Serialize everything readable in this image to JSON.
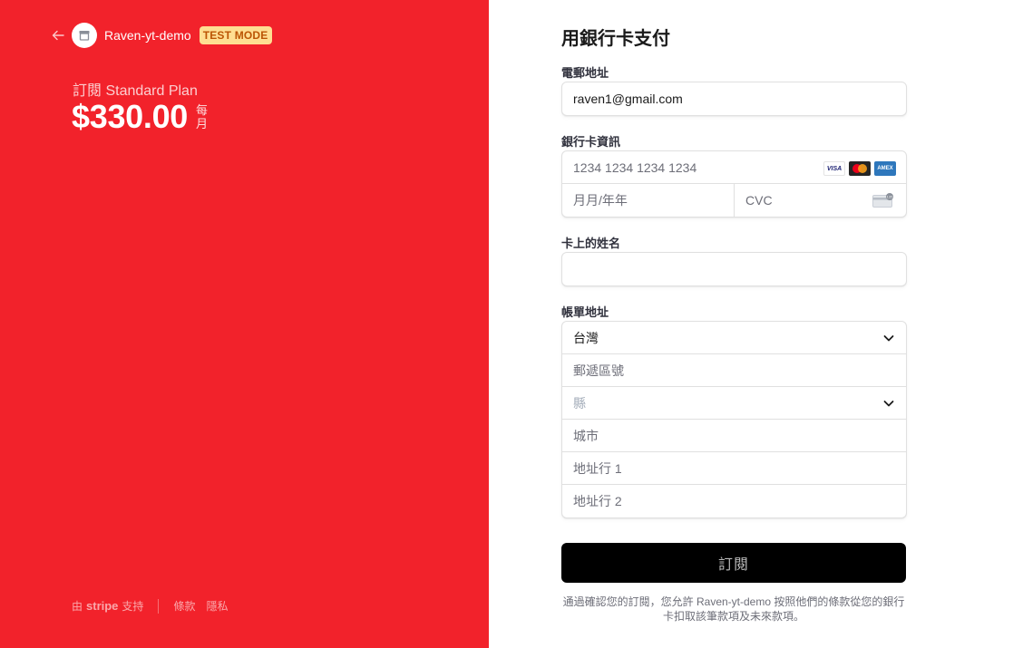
{
  "merchant": {
    "name": "Raven-yt-demo",
    "badge": "TEST MODE"
  },
  "summary": {
    "plan_label": "訂閱 Standard Plan",
    "price": "$330.00",
    "period": "每月"
  },
  "footer": {
    "powered_prefix": "由",
    "brand": "stripe",
    "powered_suffix": "支持",
    "terms_link": "條款",
    "privacy_link": "隱私"
  },
  "form": {
    "title": "用銀行卡支付",
    "email": {
      "label": "電郵地址",
      "value": "raven1@gmail.com"
    },
    "card": {
      "label": "銀行卡資訊",
      "number_placeholder": "1234 1234 1234 1234",
      "expiry_placeholder": "月月/年年",
      "cvc_placeholder": "CVC",
      "brands": [
        "VISA",
        "mastercard",
        "AMEX"
      ]
    },
    "name": {
      "label": "卡上的姓名",
      "value": ""
    },
    "billing": {
      "label": "帳單地址",
      "country": "台灣",
      "postal_placeholder": "郵遞區號",
      "county_placeholder": "縣",
      "city_placeholder": "城市",
      "line1_placeholder": "地址行 1",
      "line2_placeholder": "地址行 2"
    },
    "submit_label": "訂閱",
    "terms_text": "通過確認您的訂閱，您允許 Raven-yt-demo 按照他們的條款從您的銀行卡扣取該筆款項及未來款項。"
  },
  "colors": {
    "left_panel": "#f2222b",
    "badge_bg": "#ffde92",
    "badge_text": "#bb5504",
    "button_bg": "#000000"
  }
}
